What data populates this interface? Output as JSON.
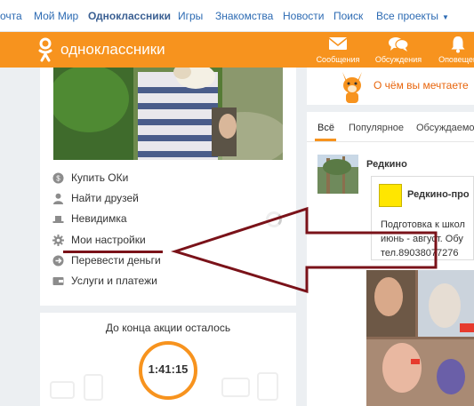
{
  "topnav": {
    "items": [
      {
        "label": "очта"
      },
      {
        "label": "Мой Мир"
      },
      {
        "label": "Одноклассники"
      },
      {
        "label": "Игры"
      },
      {
        "label": "Знакомства"
      },
      {
        "label": "Новости"
      },
      {
        "label": "Поиск"
      },
      {
        "label": "Все проекты"
      }
    ]
  },
  "header": {
    "brand": "одноклассники",
    "nav": [
      {
        "label": "Сообщения",
        "icon": "envelope-icon"
      },
      {
        "label": "Обсуждения",
        "icon": "speech-bubbles-icon"
      },
      {
        "label": "Оповещен",
        "icon": "bell-icon"
      }
    ],
    "accent": "#f7931e"
  },
  "sidebar": {
    "menu": [
      {
        "label": "Купить ОКи",
        "icon": "coins-icon"
      },
      {
        "label": "Найти друзей",
        "icon": "person-icon"
      },
      {
        "label": "Невидимка",
        "icon": "hat-icon"
      },
      {
        "label": "Мои настройки",
        "icon": "gear-icon"
      },
      {
        "label": "Перевести деньги",
        "icon": "money-transfer-icon"
      },
      {
        "label": "Услуги и платежи",
        "icon": "wallet-icon"
      }
    ]
  },
  "promo_timer": {
    "title": "До конца акции осталось",
    "time": "1:41:15"
  },
  "promo_banner": {
    "text": "О чём вы мечтаете"
  },
  "feed": {
    "tabs": [
      {
        "label": "Всё"
      },
      {
        "label": "Популярное"
      },
      {
        "label": "Обсуждаемо"
      }
    ],
    "post": {
      "author": "Редкино",
      "repost_title": "Редкино-про",
      "lines": [
        "Подготовка к школ",
        "июнь - август. Обу",
        "тел.89038077276"
      ]
    }
  },
  "annotation": {
    "color": "#7a1219"
  }
}
